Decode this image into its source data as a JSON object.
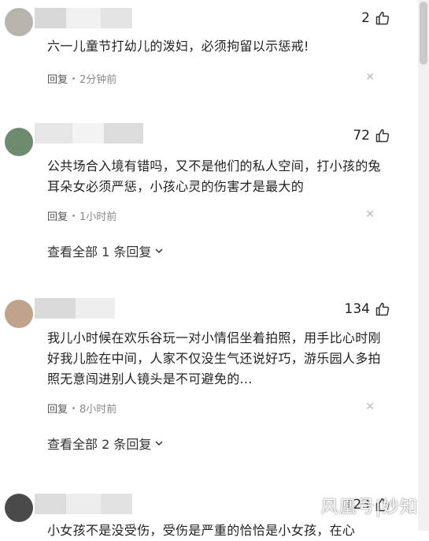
{
  "comments": [
    {
      "likes": "2",
      "text": "六一儿童节打幼儿的泼妇，必须拘留以示惩戒!",
      "reply_label": "回复",
      "time": "2分钟前"
    },
    {
      "likes": "72",
      "text": "公共场合入境有错吗，又不是他们的私人空间，打小孩的兔耳朵女必须严惩，小孩心灵的伤害才是最大的",
      "reply_label": "回复",
      "time": "1小时前",
      "view_more": "查看全部 1 条回复"
    },
    {
      "likes": "134",
      "text": "我儿小时候在欢乐谷玩一对小情侣坐着拍照，用手比心时刚好我儿脸在中间，人家不仅没生气还说好巧，游乐园人多拍照无意闯进别人镜头是不可避免的...",
      "reply_label": "回复",
      "time": "8小时前",
      "view_more": "查看全部 2 条回复"
    },
    {
      "likes": "123",
      "text": "小女孩不是没受伤，受伤是严重的恰恰是小女孩，在心"
    }
  ],
  "watermark": "风凰号|妙知",
  "icons": {
    "like": "thumbs-up-icon",
    "close": "close-icon",
    "chevron": "chevron-down-icon"
  }
}
